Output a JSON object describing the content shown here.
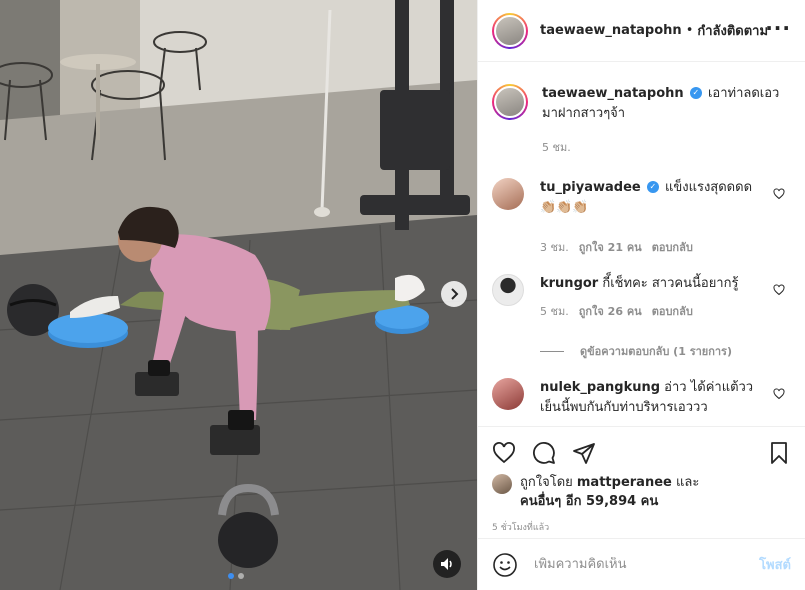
{
  "post": {
    "username": "taewaew_natapohn",
    "follow_state": "กำลังติดตาม",
    "more_icon": "more-horizontal-icon",
    "caption_rest": "เอาท่าลดเอวมาฝากสาวๆจ้า",
    "caption_time": "5 ชม.",
    "liked_by_prefix": "ถูกใจโดย",
    "liked_by_user": "mattperanee",
    "liked_by_and": "และ",
    "liked_by_others": "คนอื่นๆ อีก 59,894 คน",
    "post_time": "5 ชั่วโมงที่แล้ว"
  },
  "comments": [
    {
      "username": "tu_piyawadee",
      "verified": true,
      "text": "แข็งแรงสุดดดด 👏🏼👏🏼👏🏼",
      "time": "3 ชม.",
      "likes": "ถูกใจ 21 คน",
      "reply": "ตอบกลับ"
    },
    {
      "username": "krungor",
      "verified": false,
      "text": "กี็เช็ทคะ สาวคนนี้อยากรู้",
      "time": "5 ชม.",
      "likes": "ถูกใจ 26 คน",
      "reply": "ตอบกลับ",
      "view_replies": "ดูข้อความตอบกลับ (1 รายการ)"
    },
    {
      "username": "nulek_pangkung",
      "verified": false,
      "text": "อ่าว ได้ค่าแต้ววเย็นนี้พบกันกับท่าบริหารเอววว"
    }
  ],
  "add_comment": {
    "placeholder": "เพิ่มความคิดเห็น",
    "post_label": "โพสต์"
  },
  "media": {
    "slide_count": 2,
    "active_slide": 1
  },
  "colors": {
    "link_blue": "#3897f0",
    "post_disabled": "#b3dbff",
    "secondary_text": "#8e8e8e"
  }
}
